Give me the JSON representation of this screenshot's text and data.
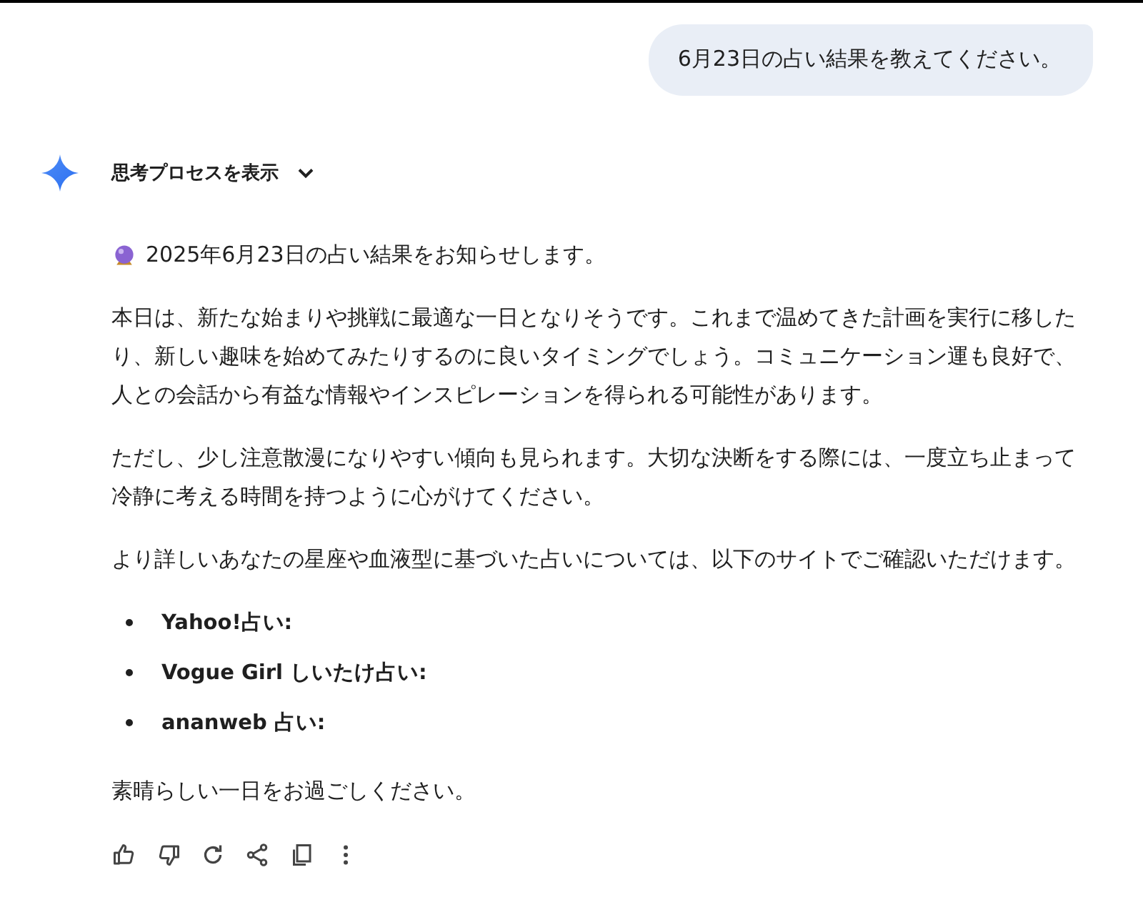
{
  "user_message": "6月23日の占い結果を教えてください。",
  "thinking_toggle": {
    "label": "思考プロセスを表示",
    "expanded": false
  },
  "response": {
    "intro": "2025年6月23日の占い結果をお知らせします。",
    "paragraphs": [
      "本日は、新たな始まりや挑戦に最適な一日となりそうです。これまで温めてきた計画を実行に移したり、新しい趣味を始めてみたりするのに良いタイミングでしょう。コミュニケーション運も良好で、人との会話から有益な情報やインスピレーションを得られる可能性があります。",
      "ただし、少し注意散漫になりやすい傾向も見られます。大切な決断をする際には、一度立ち止まって冷静に考える時間を持つように心がけてください。",
      "より詳しいあなたの星座や血液型に基づいた占いについては、以下のサイトでご確認いただけます。"
    ],
    "links": [
      "Yahoo!占い:",
      "Vogue Girl しいたけ占い:",
      "ananweb 占い:"
    ],
    "closing": "素晴らしい一日をお過ごしください。"
  },
  "actions": [
    {
      "kind": "like"
    },
    {
      "kind": "dislike"
    },
    {
      "kind": "redo"
    },
    {
      "kind": "share"
    },
    {
      "kind": "copy"
    },
    {
      "kind": "more"
    }
  ]
}
